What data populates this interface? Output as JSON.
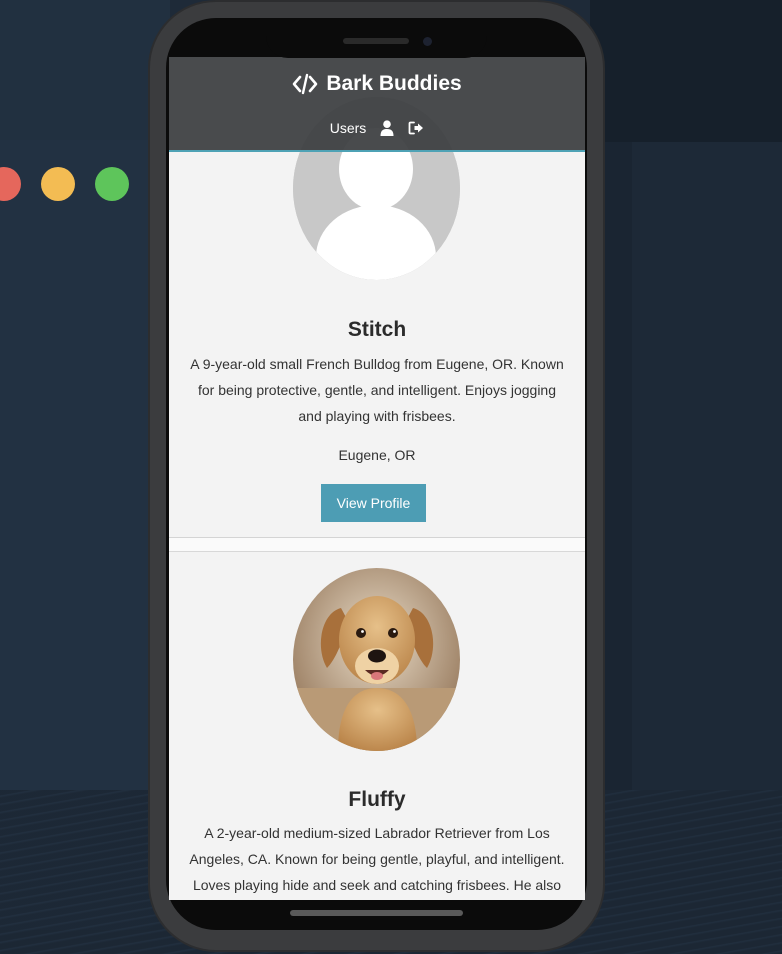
{
  "window": {
    "controls": [
      "close",
      "minimize",
      "maximize"
    ]
  },
  "app": {
    "brand": "Bark Buddies",
    "brand_icon": "code-icon",
    "nav": {
      "users_label": "Users",
      "profile_icon": "user-icon",
      "logout_icon": "sign-out-icon"
    }
  },
  "dogs": [
    {
      "name": "Stitch",
      "bio": "A 9-year-old small French Bulldog from Eugene, OR. Known for being protective, gentle, and intelligent. Enjoys jogging and playing with frisbees.",
      "location": "Eugene, OR",
      "button_label": "View Profile",
      "photo": "placeholder-avatar"
    },
    {
      "name": "Fluffy",
      "bio": "A 2-year-old medium-sized Labrador Retriever from Los Angeles, CA. Known for being gentle, playful, and intelligent. Loves playing hide and seek and catching frisbees. He also likes to rip couches",
      "photo": "labrador-puppy-photo"
    }
  ],
  "colors": {
    "header_bg": "#3e4042",
    "accent": "#4d9db4",
    "card_bg": "#f3f3f3"
  }
}
